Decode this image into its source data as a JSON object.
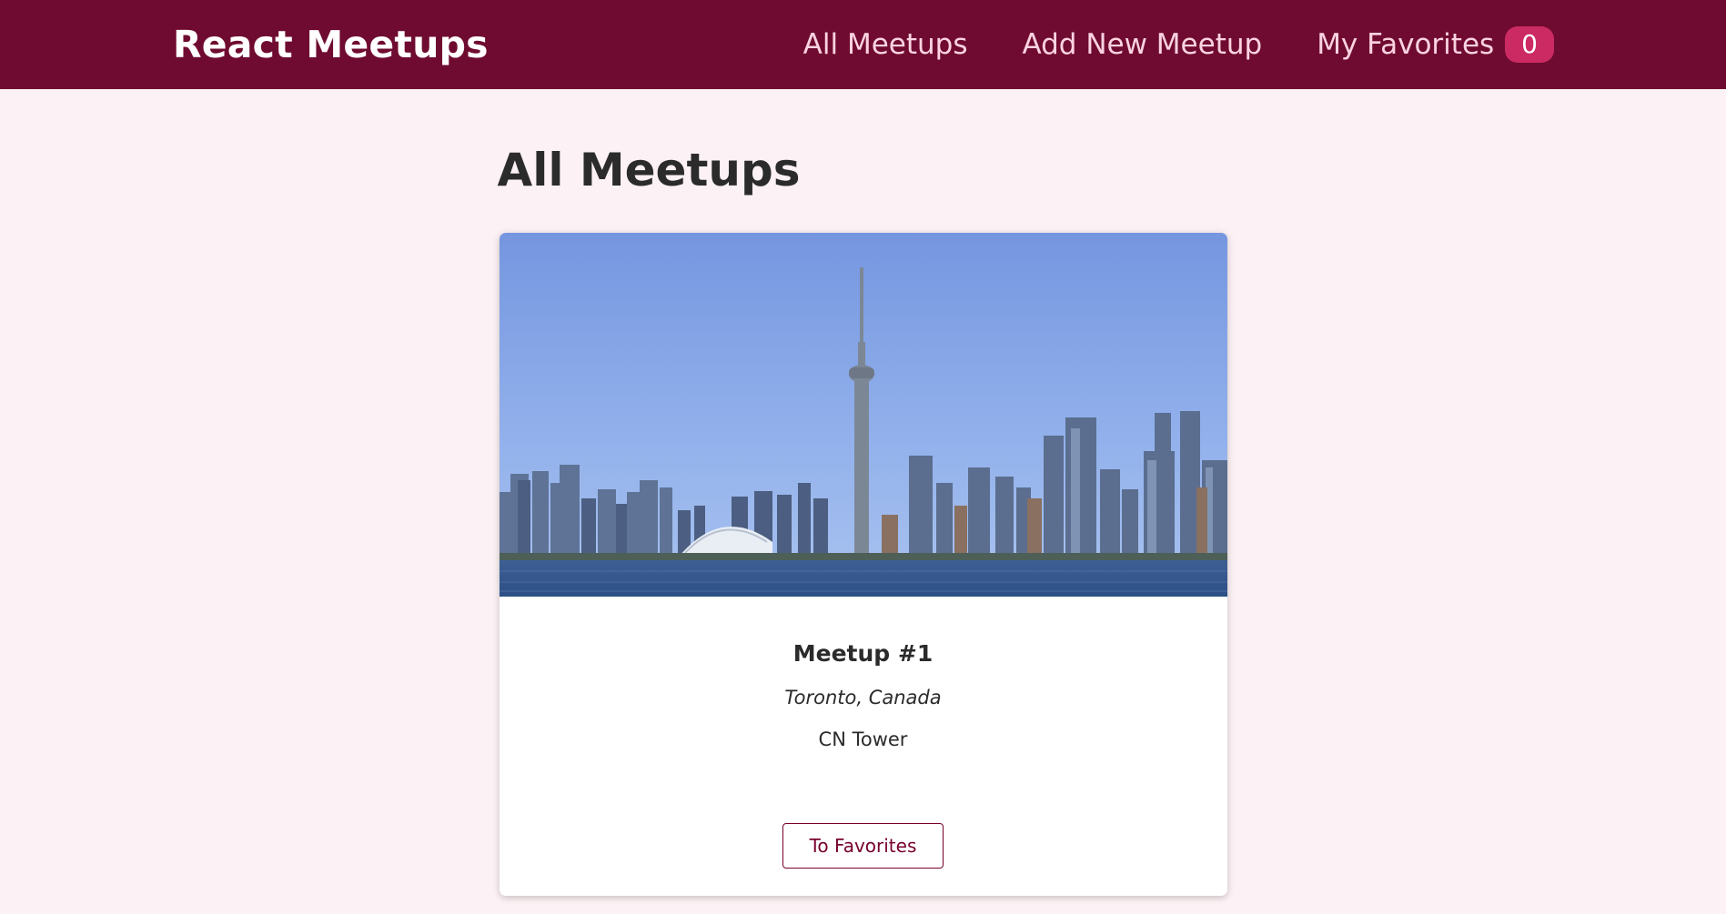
{
  "header": {
    "logo": "React Meetups",
    "nav": {
      "all_meetups": "All Meetups",
      "add_new_meetup": "Add New Meetup",
      "my_favorites": "My Favorites",
      "favorites_count": "0"
    }
  },
  "main": {
    "title": "All Meetups",
    "meetups": [
      {
        "image_alt": "Toronto skyline with CN Tower",
        "title": "Meetup #1",
        "address": "Toronto, Canada",
        "description": "CN Tower",
        "favorite_label": "To Favorites"
      }
    ]
  },
  "colors": {
    "header_bg": "#6f0b30",
    "nav_text": "#fbd3e1",
    "badge_bg": "#cc2a62",
    "page_bg": "#fcf1f4",
    "button_border": "#77002e"
  }
}
